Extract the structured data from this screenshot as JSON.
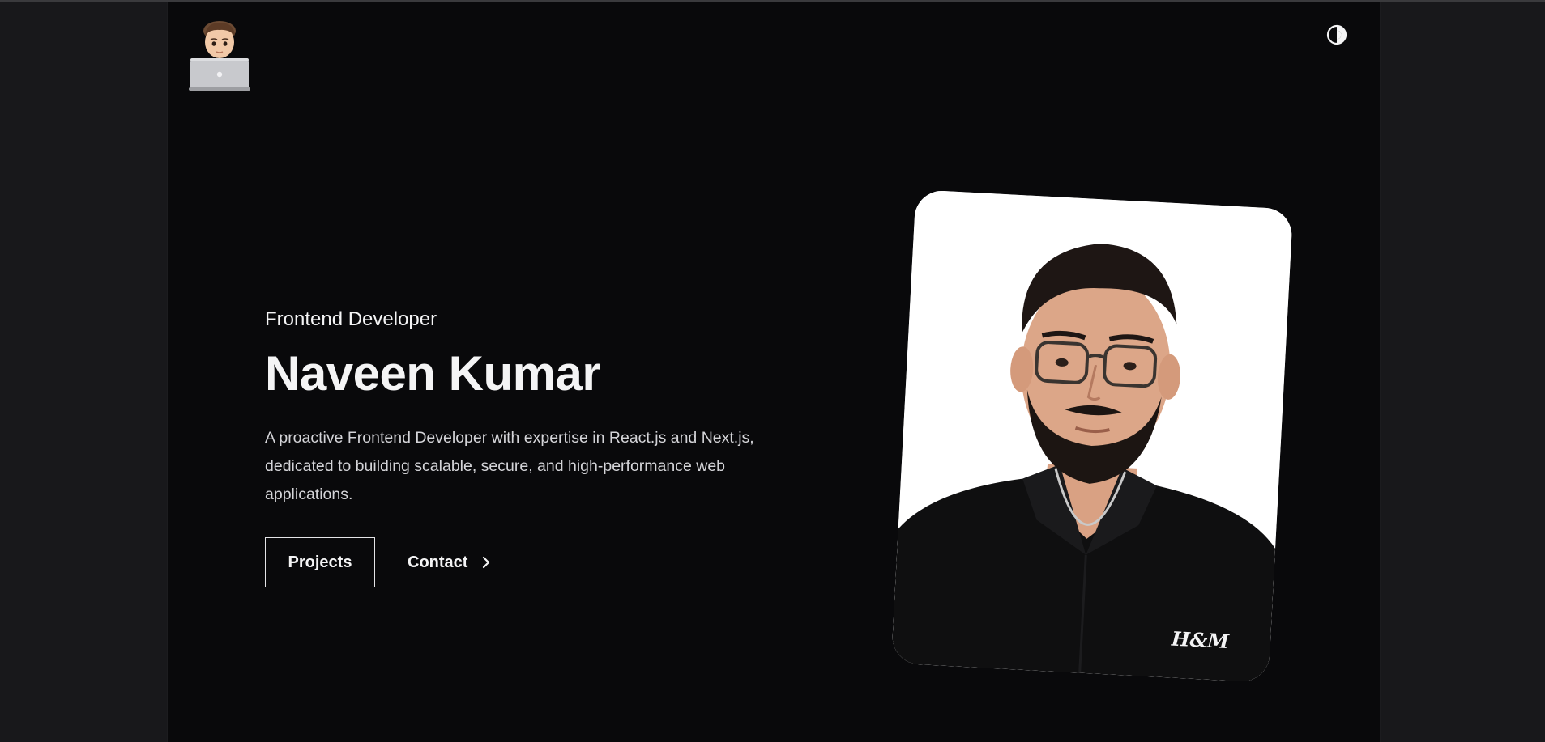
{
  "header": {
    "avatar_icon": "memoji-laptop-avatar",
    "theme_toggle_icon": "half-circle-theme-icon"
  },
  "hero": {
    "role": "Frontend Developer",
    "name": "Naveen Kumar",
    "bio": "A proactive Frontend Developer with expertise in React.js and Next.js, dedicated to building scalable, secure, and high-performance web applications.",
    "projects_label": "Projects",
    "contact_label": "Contact",
    "contact_icon": "chevron-right-icon"
  },
  "photo": {
    "shirt_logo": "H&M"
  },
  "colors": {
    "page_bg": "#18181b",
    "container_bg": "#09090b",
    "text_primary": "#f4f4f5",
    "text_secondary": "#d4d4d8"
  }
}
